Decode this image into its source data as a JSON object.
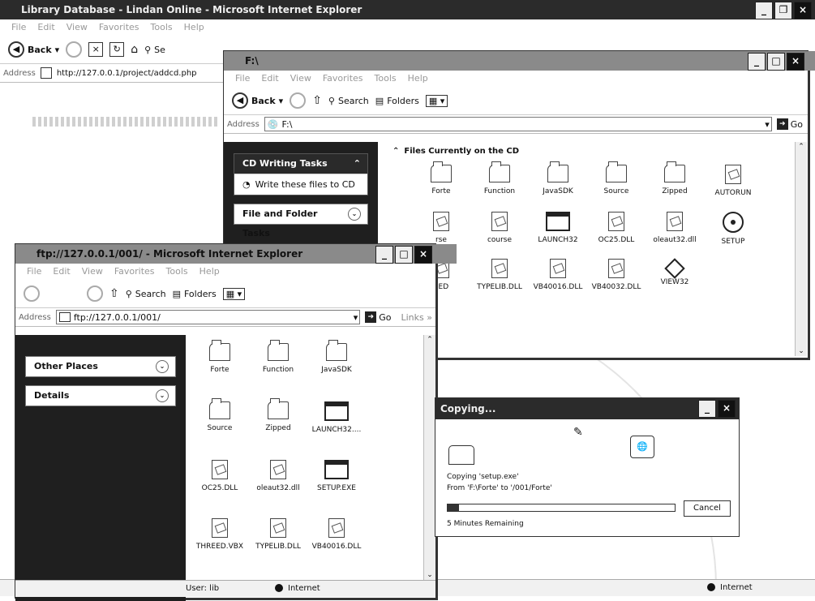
{
  "ie_main": {
    "title": "Library Database - Lindan Online - Microsoft Internet Explorer",
    "menu": [
      "File",
      "Edit",
      "View",
      "Favorites",
      "Tools",
      "Help"
    ],
    "back_label": "Back",
    "search_label": "Se",
    "address_label": "Address",
    "address_value": "http://127.0.0.1/project/addcd.php",
    "status_zone": "Internet"
  },
  "explorer_cd": {
    "title": "F:\\",
    "menu": [
      "File",
      "Edit",
      "View",
      "Favorites",
      "Tools",
      "Help"
    ],
    "back_label": "Back",
    "search_label": "Search",
    "folders_label": "Folders",
    "address_label": "Address",
    "address_value": "F:\\",
    "go_label": "Go",
    "tasks_header": "CD Writing Tasks",
    "write_task": "Write these files to CD",
    "file_tasks_header": "File and Folder Tasks",
    "section_title": "Files Currently on the CD",
    "items": [
      {
        "label": "Forte",
        "icon": "folder-icon"
      },
      {
        "label": "Function",
        "icon": "folder-icon"
      },
      {
        "label": "JavaSDK",
        "icon": "folder-icon"
      },
      {
        "label": "Source",
        "icon": "folder-icon"
      },
      {
        "label": "Zipped",
        "icon": "folder-icon"
      },
      {
        "label": "AUTORUN",
        "icon": "inf-file-icon"
      },
      {
        "label": "rse",
        "icon": "file-icon"
      },
      {
        "label": "course",
        "icon": "file-icon"
      },
      {
        "label": "LAUNCH32",
        "icon": "exe-icon"
      },
      {
        "label": "OC25.DLL",
        "icon": "dll-icon"
      },
      {
        "label": "oleaut32.dll",
        "icon": "dll-icon"
      },
      {
        "label": "SETUP",
        "icon": "setup-disc-icon"
      },
      {
        "label": "EED",
        "icon": "file-icon"
      },
      {
        "label": "TYPELIB.DLL",
        "icon": "dll-icon"
      },
      {
        "label": "VB40016.DLL",
        "icon": "dll-icon"
      },
      {
        "label": "VB40032.DLL",
        "icon": "dll-icon"
      },
      {
        "label": "VIEW32",
        "icon": "view32-icon"
      }
    ]
  },
  "ftp_window": {
    "title": "ftp://127.0.0.1/001/ - Microsoft Internet Explorer",
    "menu": [
      "File",
      "Edit",
      "View",
      "Favorites",
      "Tools",
      "Help"
    ],
    "search_label": "Search",
    "folders_label": "Folders",
    "address_label": "Address",
    "address_value": "ftp://127.0.0.1/001/",
    "go_label": "Go",
    "links_label": "Links",
    "other_places": "Other Places",
    "details": "Details",
    "items": [
      {
        "label": "Forte",
        "icon": "folder-icon"
      },
      {
        "label": "Function",
        "icon": "folder-icon"
      },
      {
        "label": "JavaSDK",
        "icon": "folder-icon"
      },
      {
        "label": "Source",
        "icon": "folder-icon"
      },
      {
        "label": "Zipped",
        "icon": "folder-icon"
      },
      {
        "label": "LAUNCH32....",
        "icon": "exe-icon"
      },
      {
        "label": "OC25.DLL",
        "icon": "dll-icon"
      },
      {
        "label": "oleaut32.dll",
        "icon": "dll-icon"
      },
      {
        "label": "SETUP.EXE",
        "icon": "exe-icon"
      },
      {
        "label": "THREED.VBX",
        "icon": "vbx-icon"
      },
      {
        "label": "TYPELIB.DLL",
        "icon": "dll-icon"
      },
      {
        "label": "VB40016.DLL",
        "icon": "dll-icon"
      }
    ],
    "status_user": "User: lib",
    "status_zone": "Internet"
  },
  "copy_dialog": {
    "title": "Copying...",
    "line1": "Copying 'setup.exe'",
    "line2": "From 'F:\\Forte' to '/001/Forte'",
    "progress": 0.05,
    "remaining": "5 Minutes Remaining",
    "cancel_label": "Cancel"
  }
}
